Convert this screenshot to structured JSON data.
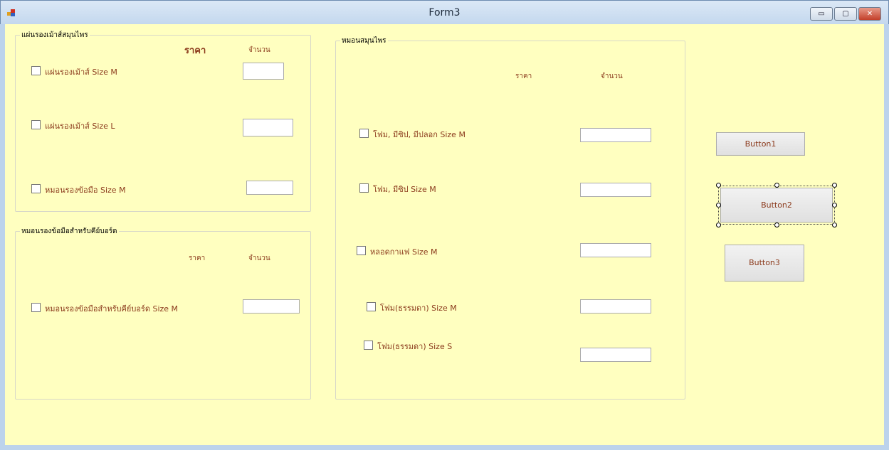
{
  "window": {
    "title": "Form3",
    "minimize": "▭",
    "restore": "▢",
    "close": "✕"
  },
  "group1": {
    "title": "แผ่นรองเม้าส์สมุนไพร",
    "price_header": "ราคา",
    "qty_header": "จำนวน",
    "items": [
      {
        "label": "แผ่นรองเม้าส์   Size M",
        "qty": ""
      },
      {
        "label": "แผ่นรองเม้าส์   Size L",
        "qty": ""
      },
      {
        "label": "หมอนรองข้อมือ   Size M",
        "qty": ""
      }
    ]
  },
  "group2": {
    "title": "หมอนรองข้อมือสำหรับคีย์บอร์ด",
    "price_header": "ราคา",
    "qty_header": "จำนวน",
    "items": [
      {
        "label": "หมอนรองข้อมือสำหรับคีย์บอร์ด  Size   M",
        "qty": ""
      }
    ]
  },
  "group3": {
    "title": "หมอนสมุนไพร",
    "price_header": "ราคา",
    "qty_header": "จำนวน",
    "items": [
      {
        "label": "โฟม, มีซิป, มีปลอก  Size  M",
        "qty": ""
      },
      {
        "label": "โฟม, มีซิป  Size  M",
        "qty": ""
      },
      {
        "label": "หลอดกาแฟ   Size  M",
        "qty": ""
      },
      {
        "label": "โฟม(ธรรมดา)  Size  M",
        "qty": ""
      },
      {
        "label": "โฟม(ธรรมดา) Size  S",
        "qty": ""
      }
    ]
  },
  "buttons": {
    "button1": "Button1",
    "button2": "Button2",
    "button3": "Button3"
  }
}
